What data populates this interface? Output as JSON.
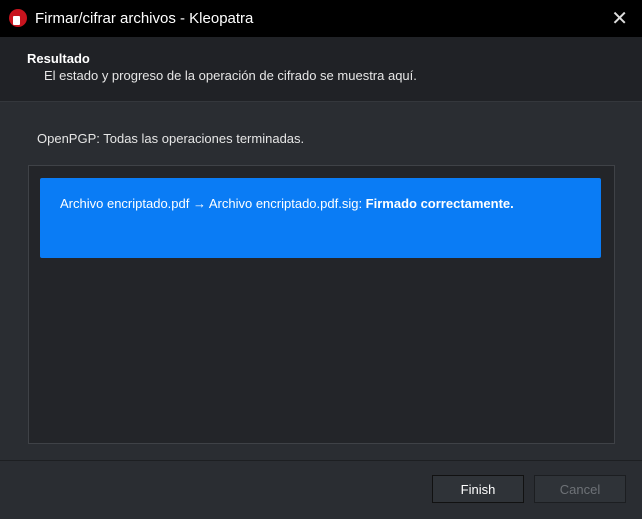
{
  "window": {
    "title": "Firmar/cifrar archivos - Kleopatra",
    "close_icon": "close-icon"
  },
  "header": {
    "title": "Resultado",
    "subtitle": "El estado y progreso de la operación de cifrado se muestra aquí."
  },
  "status": "OpenPGP: Todas las operaciones terminadas.",
  "results": [
    {
      "text": "Archivo encriptado.pdf → Archivo encriptado.pdf.sig: ",
      "result": "Firmado correctamente.",
      "color": "#0a7cf5"
    }
  ],
  "buttons": {
    "finish": "Finish",
    "cancel": "Cancel"
  }
}
